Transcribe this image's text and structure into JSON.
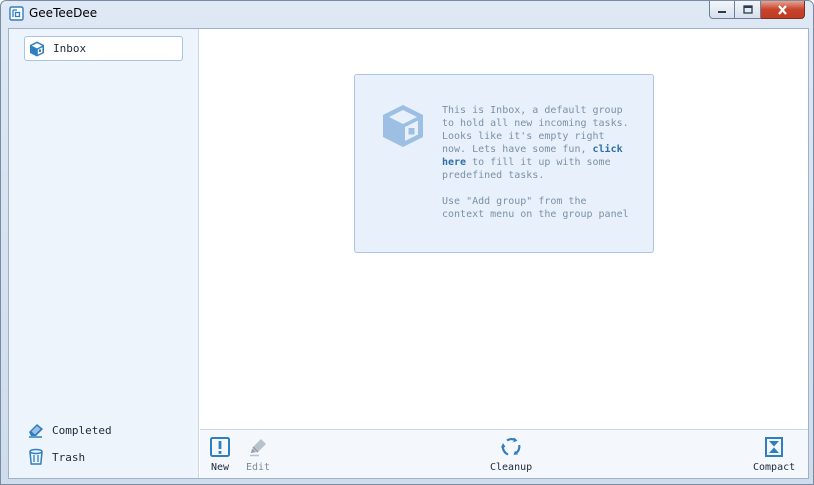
{
  "window": {
    "title": "GeeTeeDee"
  },
  "sidebar": {
    "groups": [
      {
        "label": "Inbox",
        "icon": "box-icon",
        "selected": true
      }
    ],
    "bottom_links": [
      {
        "label": "Completed",
        "icon": "eraser-icon"
      },
      {
        "label": "Trash",
        "icon": "trash-icon"
      }
    ]
  },
  "info": {
    "line_1": "This is Inbox, a default group",
    "line_2": "to hold all new incoming tasks.",
    "line_3": "Looks like it's empty right",
    "line_4_prefix": "now. Lets have some fun, ",
    "link_1": "click",
    "link_2": "here",
    "line_5_suffix": " to fill it up with some",
    "line_6": "predefined tasks.",
    "line_7": "Use \"Add group\" from the",
    "line_8": "context menu on the group panel"
  },
  "toolbar": {
    "new_label": "New",
    "edit_label": "Edit",
    "cleanup_label": "Cleanup",
    "compact_label": "Compact"
  },
  "colors": {
    "accent": "#2f7fc0",
    "icon_light": "#9dbfe3",
    "sidebar_bg": "#edf4fc",
    "info_bg": "#e8f1fb"
  }
}
